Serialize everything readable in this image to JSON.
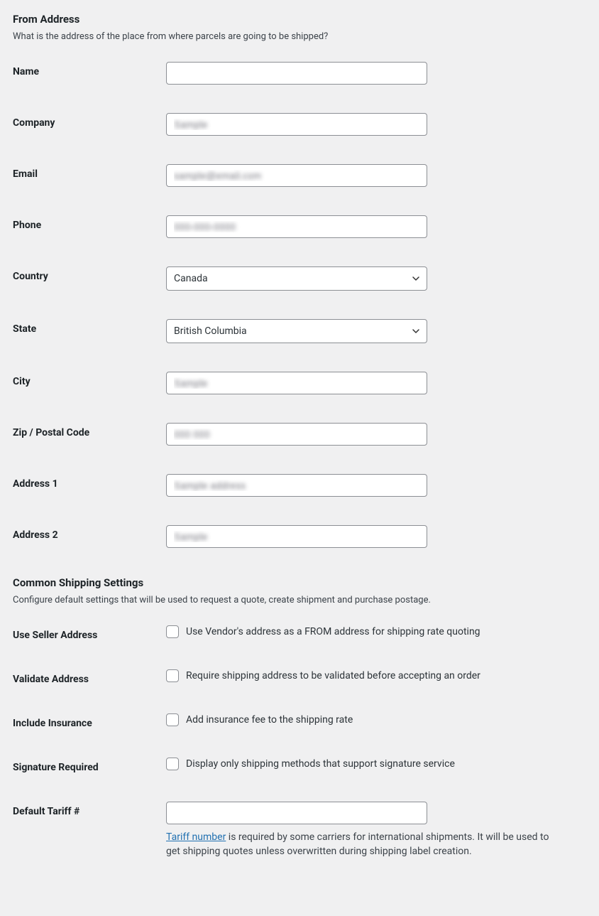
{
  "from_address": {
    "title": "From Address",
    "description": "What is the address of the place from where parcels are going to be shipped?",
    "fields": {
      "name": {
        "label": "Name",
        "value": ""
      },
      "company": {
        "label": "Company",
        "value": "Sample"
      },
      "email": {
        "label": "Email",
        "value": "sample@email.com"
      },
      "phone": {
        "label": "Phone",
        "value": "000-000-0000"
      },
      "country": {
        "label": "Country",
        "value": "Canada"
      },
      "state": {
        "label": "State",
        "value": "British Columbia"
      },
      "city": {
        "label": "City",
        "value": "Sample"
      },
      "zip": {
        "label": "Zip / Postal Code",
        "value": "000 000"
      },
      "address1": {
        "label": "Address 1",
        "value": "Sample address"
      },
      "address2": {
        "label": "Address 2",
        "value": "Sample"
      }
    }
  },
  "common_shipping": {
    "title": "Common Shipping Settings",
    "description": "Configure default settings that will be used to request a quote, create shipment and purchase postage.",
    "use_seller_address": {
      "label": "Use Seller Address",
      "checkbox_label": "Use Vendor's address as a FROM address for shipping rate quoting"
    },
    "validate_address": {
      "label": "Validate Address",
      "checkbox_label": "Require shipping address to be validated before accepting an order"
    },
    "include_insurance": {
      "label": "Include Insurance",
      "checkbox_label": "Add insurance fee to the shipping rate"
    },
    "signature_required": {
      "label": "Signature Required",
      "checkbox_label": "Display only shipping methods that support signature service"
    },
    "default_tariff": {
      "label": "Default Tariff #",
      "value": "",
      "help_link_text": "Tariff number",
      "help_text_rest": " is required by some carriers for international shipments. It will be used to get shipping quotes unless overwritten during shipping label creation."
    }
  }
}
